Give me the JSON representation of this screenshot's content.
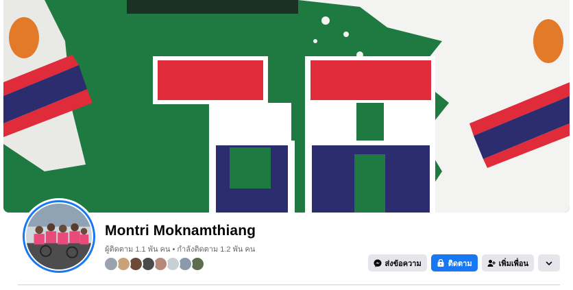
{
  "profile": {
    "name": "Montri Moknamthiang",
    "stats": "ผู้ติดตาม 1.1 พัน คน • กำลังติดตาม 1.2 พัน คน"
  },
  "actions": {
    "message_label": "ส่งข้อความ",
    "follow_label": "ติดตาม",
    "add_friend_label": "เพิ่มเพื่อน"
  },
  "friends_preview": [
    {
      "color": "#9aa3ad"
    },
    {
      "color": "#c9a27a"
    },
    {
      "color": "#6b4a3a"
    },
    {
      "color": "#4a4a4a"
    },
    {
      "color": "#b58a7a"
    },
    {
      "color": "#c7d0d6"
    },
    {
      "color": "#8a9aa8"
    },
    {
      "color": "#5d6d4e"
    }
  ],
  "colors": {
    "accent": "#1877f2",
    "secondary_button": "#e4e6eb",
    "muted_text": "#65676b",
    "jersey_green": "#1f7a42",
    "jersey_red": "#e02b3a",
    "jersey_navy": "#2b2d6e"
  },
  "icons": {
    "message": "messenger-icon",
    "follow": "follow-lock-icon",
    "add_friend": "add-friend-icon",
    "more": "chevron-down-icon"
  }
}
